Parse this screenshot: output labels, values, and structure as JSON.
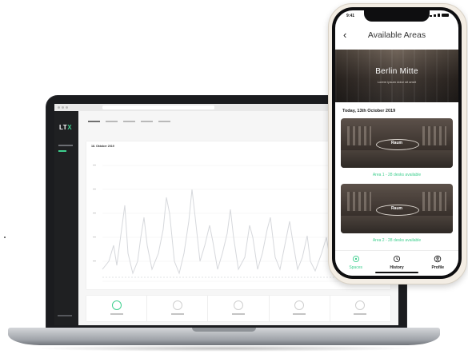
{
  "laptop": {
    "app_logo": "LT",
    "app_logo_accent": "X",
    "chart_date": "18. Oktober 2019",
    "accent_color": "#3ecf8e",
    "sidebar_color": "#1f2022"
  },
  "phone": {
    "status_time": "9:41",
    "title": "Available Areas",
    "back_icon": "chevron-left-icon",
    "banner_title": "Berlin Mitte",
    "banner_subtitle": "Lorem ipsum dolor sit amet",
    "date_heading": "Today, 13th October 2019",
    "areas": [
      {
        "label": "Raum",
        "availability": "Area 1 - 28 desks available"
      },
      {
        "label": "Raum",
        "availability": "Area 2 - 28 desks available"
      }
    ],
    "nav": [
      {
        "label": "Spaces",
        "icon": "spaces-icon",
        "active": true
      },
      {
        "label": "History",
        "icon": "history-icon",
        "active": false
      },
      {
        "label": "Profile",
        "icon": "profile-icon",
        "active": false
      }
    ]
  }
}
